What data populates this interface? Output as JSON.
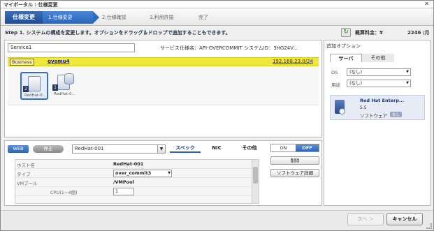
{
  "window": {
    "title": "マイポータル : 仕様変更",
    "close": "✕"
  },
  "steps": {
    "main": "仕様変更",
    "items": [
      "1.仕様変更",
      "2.仕様確認",
      "3.利用許諾",
      "完了"
    ]
  },
  "instruction": "Step 1. システムの構成を変更します。オプションをドラッグ＆ドロップで追加することもできます。",
  "refresh_icon": "↻",
  "price": {
    "label": "概算料金：¥",
    "value": "2246 /月"
  },
  "service": {
    "name": "Service1",
    "info": "サービス仕様名：API-OVERCOMMIT  システムID：3HG24V..."
  },
  "network": {
    "segment": "Business",
    "name": "gyomu4",
    "subnet": "192.168.23.0/24"
  },
  "servers": [
    {
      "num": "2",
      "label": "RedHat-0..."
    },
    {
      "num": "1",
      "label": "RedHat-0..."
    }
  ],
  "detail": {
    "web": "WEB",
    "stop": "停止",
    "name": "RedHat-001",
    "tabs": [
      "スペック",
      "NIC",
      "その他"
    ],
    "on": "ON",
    "off": "OFF",
    "delete": "削除",
    "software_detail": "ソフトウェア詳細",
    "rows": [
      {
        "k": "ホスト名",
        "v": "RedHat-001"
      },
      {
        "k": "タイプ",
        "v": "over_commit3"
      },
      {
        "k": "VMプール",
        "v": "/VMPool"
      },
      {
        "k": "CPU(1~4個)",
        "v": "1"
      }
    ]
  },
  "options": {
    "title": "追加オプション",
    "tabs": [
      "サーバ",
      "その他"
    ],
    "os_label": "OS",
    "os_value": "(なし)",
    "use_label": "用途",
    "use_value": "(なし)",
    "card": {
      "name": "Red Hat Enterp...",
      "version": "5.5",
      "type": "ソフトウェア",
      "badge": "なし"
    }
  },
  "footer": {
    "next": "次へ ＞",
    "cancel": "キャンセル"
  }
}
